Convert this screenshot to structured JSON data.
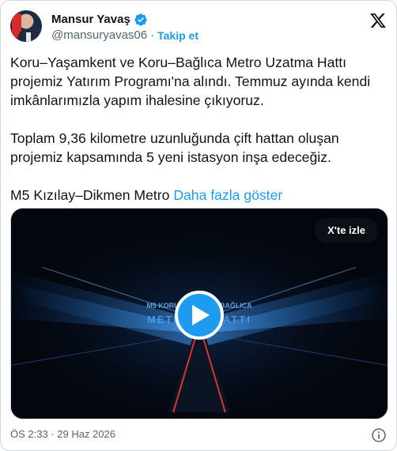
{
  "author": {
    "name": "Mansur Yavaş",
    "handle": "@mansuryavas06",
    "separator": "·",
    "follow_label": "Takip et"
  },
  "tweet": {
    "paragraph1": "Koru–Yaşamkent ve Koru–Bağlıca Metro Uzatma Hattı projemiz Yatırım Programı'na alındı. Temmuz ayında kendi imkânlarımızla yapım ihalesine çıkıyoruz.",
    "paragraph2": "Toplam 9,36 kilometre uzunluğunda çift hattan oluşan projemiz kapsamında 5 yeni istasyon inşa edeceğiz.",
    "paragraph3": "M5 Kızılay–Dikmen Metro",
    "show_more": "Daha fazla göster"
  },
  "media": {
    "watch_label": "X'te izle",
    "overlay_text_line1": "M5 KORU - YA... ...U - BAĞLICA",
    "overlay_text_line2": "METRO ... HATTI"
  },
  "timestamp": "ÖS 2:33 · 29 Haz 2026",
  "colors": {
    "accent": "#1d9bf0",
    "text": "#0f1419",
    "muted": "#536471",
    "border": "#cfd9de"
  },
  "icons": {
    "verified": "verified-badge-icon",
    "x_logo": "x-logo-icon",
    "play": "play-icon",
    "info": "info-icon"
  }
}
